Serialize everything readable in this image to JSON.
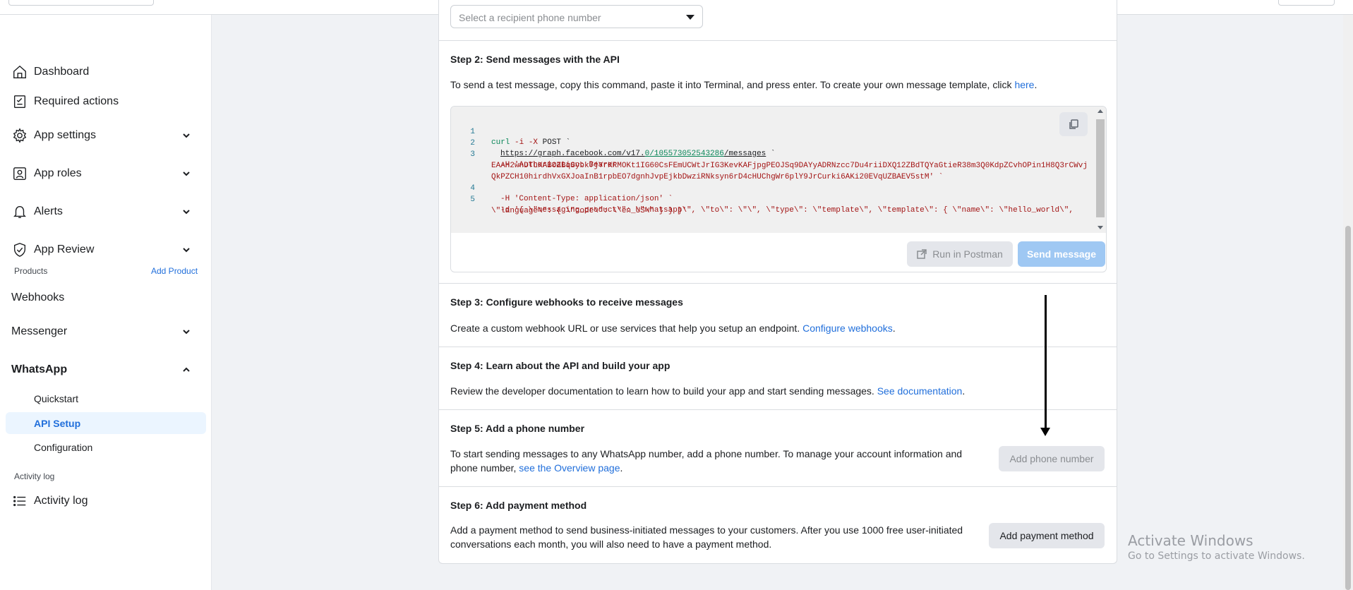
{
  "sidebar": {
    "items": [
      {
        "label": "Dashboard",
        "icon": "home-icon"
      },
      {
        "label": "Required actions",
        "icon": "checklist-icon"
      },
      {
        "label": "App settings",
        "icon": "gear-icon"
      },
      {
        "label": "App roles",
        "icon": "user-badge-icon"
      },
      {
        "label": "Alerts",
        "icon": "bell-icon"
      },
      {
        "label": "App Review",
        "icon": "shield-check-icon"
      }
    ],
    "products_label": "Products",
    "add_product": "Add Product",
    "webhooks": "Webhooks",
    "messenger": "Messenger",
    "whatsapp": "WhatsApp",
    "whatsapp_sub": [
      {
        "label": "Quickstart"
      },
      {
        "label": "API Setup"
      },
      {
        "label": "Configuration"
      }
    ],
    "activity_section": "Activity log",
    "activity_item": "Activity log"
  },
  "step1": {
    "select_placeholder": "Select a recipient phone number"
  },
  "step2": {
    "title": "Step 2: Send messages with the API",
    "text": "To send a test message, copy this command, paste it into Terminal, and press enter. To create your own message template, click ",
    "link": "here",
    "text_end": ".",
    "code": {
      "line_numbers": [
        "1",
        "2",
        "3",
        "4",
        "5"
      ],
      "l1_a": "curl ",
      "l1_b": "-i -X ",
      "l1_c": "POST `",
      "l2_a": "https://graph.facebook.com/v17.",
      "l2_b": "0/105573052543286",
      "l2_c": "/messages",
      "l2_d": " `",
      "l3": "-H 'Authorization: Bearer",
      "l3b": "EAAH2wnDTLKABOZBqSybk7jYrKRMOKt1IG60CsFEmUCWtJrIG3KevKAFjpgPEOJSq9DAYyADRNzcc7Du4riiDXQ12ZBdTQYaGtieR38m3Q0KdpZCvhOPin1H8Q3rCWvj",
      "l3c": "QkPZCH10hirdhVxGXJoaInB1rpbEO7dgnhJvpEjkbDwziRNksyn6rD4cHUChgWr6plY9JrCurki6AKi20EVqUZBAEV5stM' `",
      "l4": "-H 'Content-Type: application/json' `",
      "l5": "-d '{ \\\"messaging_product\\\": \\\"whatsapp\\\", \\\"to\\\": \\\"\\\", \\\"type\\\": \\\"template\\\", \\\"template\\\": { \\\"name\\\": \\\"hello_world\\\",",
      "l5b": "\\\"language\\\": { \\\"code\\\": \\\"en_US\\\" } } }'"
    },
    "run_postman": "Run in Postman",
    "send_message": "Send message"
  },
  "step3": {
    "title": "Step 3: Configure webhooks to receive messages",
    "text": "Create a custom webhook URL or use services that help you setup an endpoint. ",
    "link": "Configure webhooks",
    "text_end": "."
  },
  "step4": {
    "title": "Step 4: Learn about the API and build your app",
    "text": "Review the developer documentation to learn how to build your app and start sending messages. ",
    "link": "See documentation",
    "text_end": "."
  },
  "step5": {
    "title": "Step 5: Add a phone number",
    "text_line1": "To start sending messages to any WhatsApp number, add a phone number. To manage your account information and",
    "text_line2": "phone number, ",
    "link": "see the Overview page",
    "text_end": ".",
    "button": "Add phone number"
  },
  "step6": {
    "title": "Step 6: Add payment method",
    "text_line1": "Add a payment method to send business-initiated messages to your customers. After you use 1000 free user-initiated",
    "text_line2": "conversations each month, you will also need to have a payment method.",
    "button": "Add payment method"
  },
  "watermark": {
    "title": "Activate Windows",
    "subtitle": "Go to Settings to activate Windows."
  },
  "colors": {
    "accent": "#216fdb",
    "active_bg": "#ebf5ff",
    "send_disabled": "#9fc8f3"
  }
}
